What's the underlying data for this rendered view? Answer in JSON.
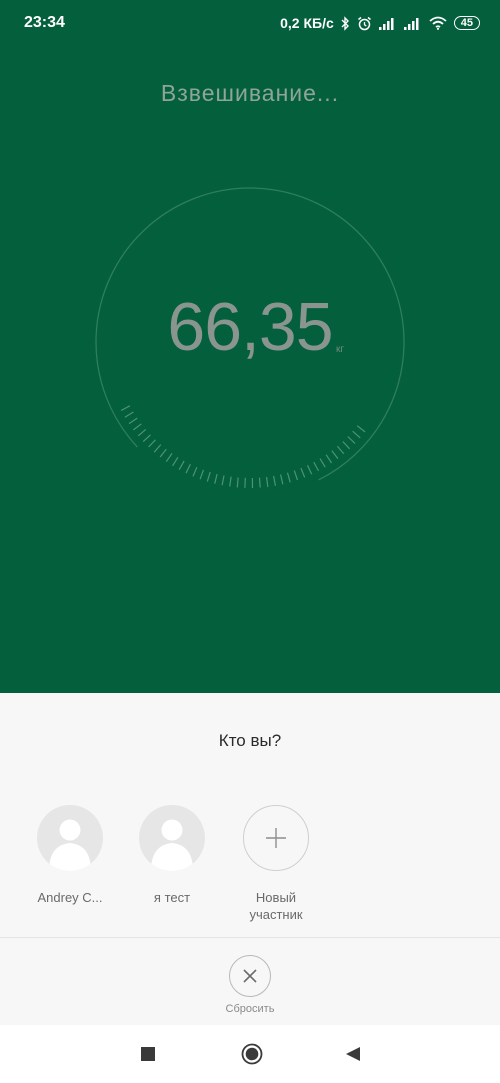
{
  "status_bar": {
    "time": "23:34",
    "network_speed": "0,2 КБ/с",
    "battery": "45",
    "icons": [
      "bluetooth-icon",
      "alarm-icon",
      "signal-icon",
      "signal-icon",
      "wifi-icon",
      "battery-icon"
    ]
  },
  "weighing": {
    "title": "Взвешивание...",
    "value": "66,35",
    "unit": "кг"
  },
  "sheet": {
    "title": "Кто вы?",
    "members": [
      {
        "name": "Andrey C...",
        "icon": "person-avatar-icon"
      },
      {
        "name": "я тест",
        "icon": "person-avatar-icon"
      },
      {
        "name_line1": "Новый",
        "name_line2": "участник",
        "icon": "plus-icon"
      }
    ],
    "reset_label": "Сбросить",
    "reset_icon": "close-icon"
  },
  "nav": {
    "icons": [
      "recents-square-icon",
      "home-circle-icon",
      "back-triangle-icon"
    ]
  },
  "colors": {
    "top_background": "#035f3c",
    "sheet_background": "#f7f7f7"
  }
}
